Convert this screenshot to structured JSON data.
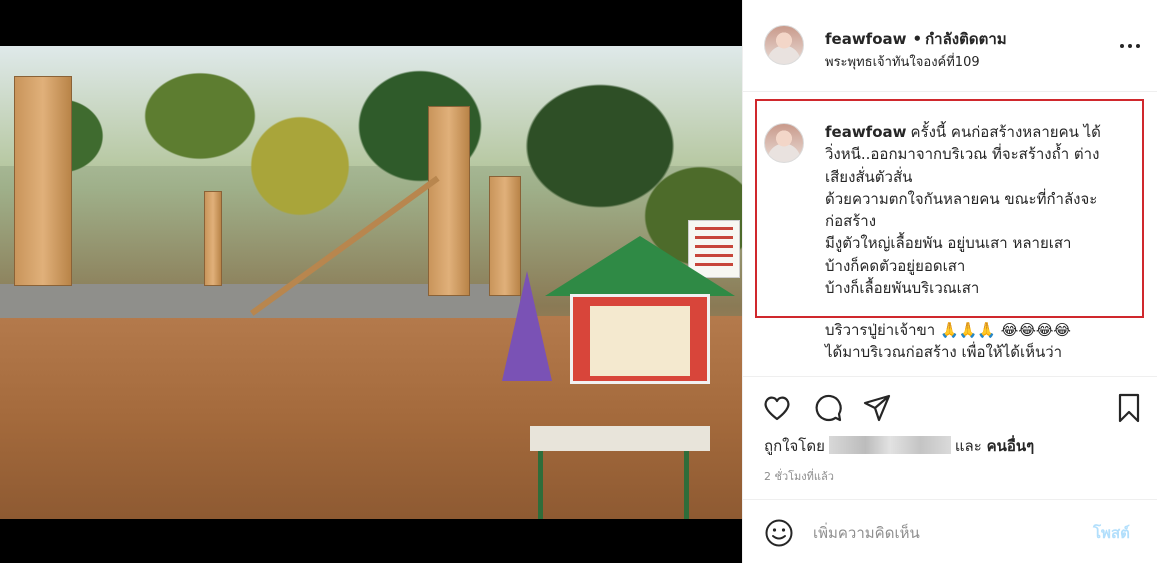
{
  "header": {
    "username": "feawfoaw",
    "dot": "•",
    "follow_status": "กำลังติดตาม",
    "location": "พระพุทธเจ้าทันใจองค์ที่109"
  },
  "caption": {
    "username": "feawfoaw",
    "lines": [
      "ครั้งนี้ คนก่อสร้างหลายคน ได้",
      "วิ่งหนี..ออกมาจากบริเวณ ที่จะสร้างถ้ำ ต่าง",
      "เสียงสั่นตัวสั่น",
      "ด้วยความตกใจกันหลายคน ขณะที่กำลังจะ",
      "ก่อสร้าง",
      "มีงูตัวใหญ่เลื้อยพัน อยู่บนเสา หลายเสา",
      "บ้างก็คดตัวอยู่ยอดเสา",
      "บ้างก็เลื้อยพันบริเวณเสา"
    ],
    "continued": [
      "บริวารปู่ย่าเจ้าขา 🙏🙏🙏 😂😂😂😂",
      "ได้มาบริเวณก่อสร้าง เพื่อให้ได้เห็นว่า"
    ]
  },
  "likes": {
    "prefix": "ถูกใจโดย",
    "conjunction": "และ",
    "others": "คนอื่นๆ"
  },
  "timestamp": "2 ชั่วโมงที่แล้ว",
  "comment_box": {
    "placeholder": "เพิ่มความคิดเห็น",
    "post_label": "โพสต์"
  },
  "colors": {
    "highlight_border": "#d0282d",
    "post_button": "#b2dffc",
    "muted_text": "#8e8e8e"
  },
  "icons": [
    "more-icon",
    "heart-icon",
    "comment-icon",
    "share-icon",
    "bookmark-icon",
    "smile-icon"
  ]
}
